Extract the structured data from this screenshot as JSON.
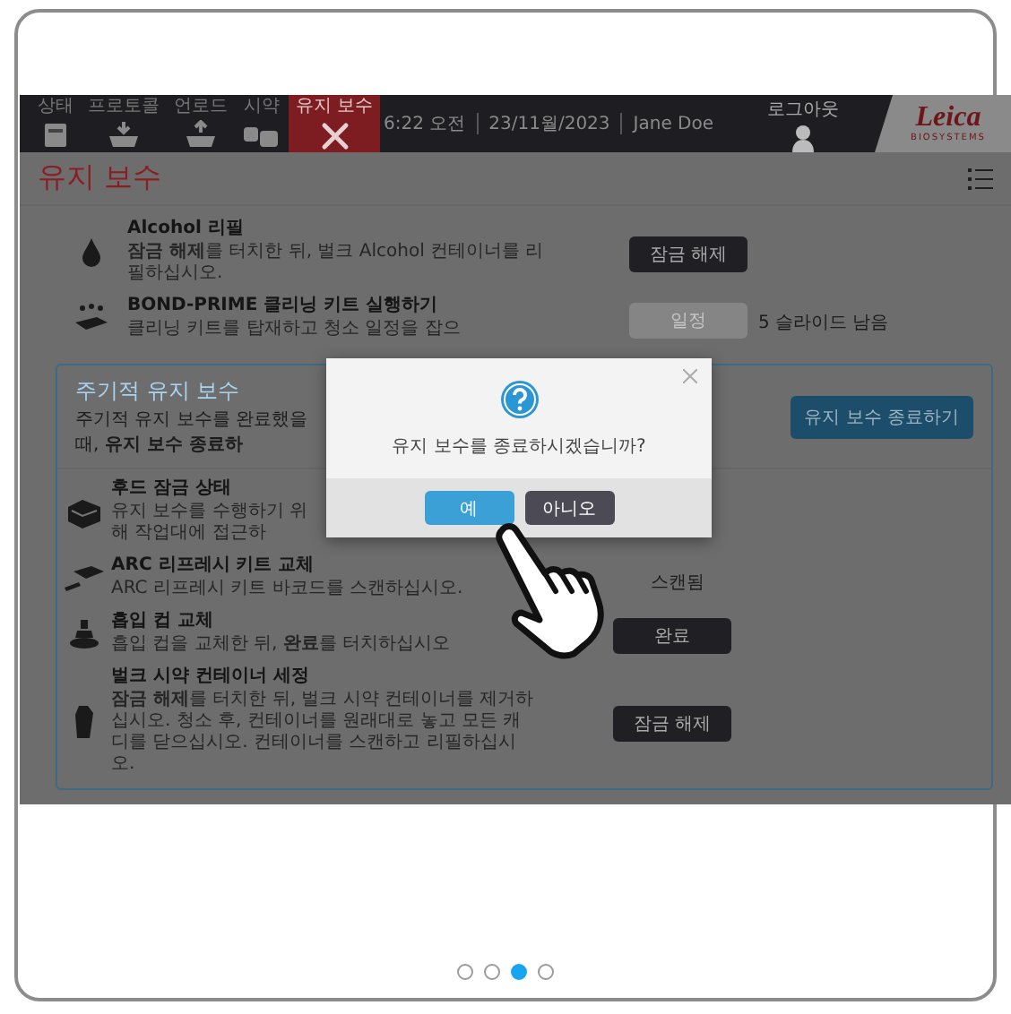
{
  "nav": [
    {
      "label": "상태",
      "kind": "status",
      "selected": false
    },
    {
      "label": "프로토콜",
      "kind": "load",
      "selected": false
    },
    {
      "label": "언로드",
      "kind": "unload",
      "selected": false
    },
    {
      "label": "시약",
      "kind": "reagent",
      "selected": false
    },
    {
      "label": "유지 보수",
      "kind": "maintenance",
      "selected": true
    }
  ],
  "header": {
    "time": "6:22 오전",
    "date": "23/11월/2023",
    "user": "Jane Doe",
    "logout": "로그아웃",
    "logo": "Leica",
    "logo_sub": "BIOSYSTEMS"
  },
  "page_title": "유지 보수",
  "tasks": [
    {
      "kind": "drop",
      "title": "Alcohol 리필",
      "description": "**잠금 해제**를 터치한 뒤, 벌크 Alcohol 컨테이너를 리필하십시오.",
      "button": {
        "label": "잠금 해제",
        "disabled": false
      }
    },
    {
      "kind": "cleaning",
      "title": "BOND-PRIME 클리닝 키트 실행하기",
      "description": "클리닝 키트를 탑재하고 청소 일정을 잡으",
      "button": {
        "label": "일정",
        "disabled": true
      },
      "status": "5 슬라이드 남음"
    }
  ],
  "periodic": {
    "title": "주기적 유지 보수",
    "description": "주기적 유지 보수를 완료했을 때, **유지 보수 종료하**",
    "end_button": "유지 보수 종료하기",
    "tasks": [
      {
        "kind": "hood",
        "title": "후드 잠금 상태",
        "description": "유지 보수를 수행하기 위해 작업대에 접근하"
      },
      {
        "kind": "kit",
        "title": "ARC 리프레시 키트 교체",
        "description": "ARC 리프레시 키트 바코드를 스캔하십시오.",
        "status": "스캔됨"
      },
      {
        "kind": "cup",
        "title": "흡입 컵 교체",
        "description": "흡입 컵을 교체한 뒤, **완료**를 터치하십시오",
        "button": {
          "label": "완료",
          "disabled": false
        }
      },
      {
        "kind": "bottle",
        "title": "벌크 시약 컨테이너 세정",
        "description": "**잠금 해제**를 터치한 뒤, 벌크 시약 컨테이너를 제거하십시오. 청소 후, 컨테이너를 원래대로 놓고 모든 캐디를 닫으십시오. 컨테이너를 스캔하고 리필하십시오.",
        "button": {
          "label": "잠금 해제",
          "disabled": false
        }
      }
    ]
  },
  "dialog": {
    "message": "유지 보수를 종료하시겠습니까?",
    "buttons": [
      {
        "label": "예",
        "kind": "primary"
      },
      {
        "label": "아니오",
        "kind": "secondary"
      }
    ]
  },
  "pager": [
    {
      "selected": false
    },
    {
      "selected": false
    },
    {
      "selected": true
    },
    {
      "selected": false
    }
  ]
}
